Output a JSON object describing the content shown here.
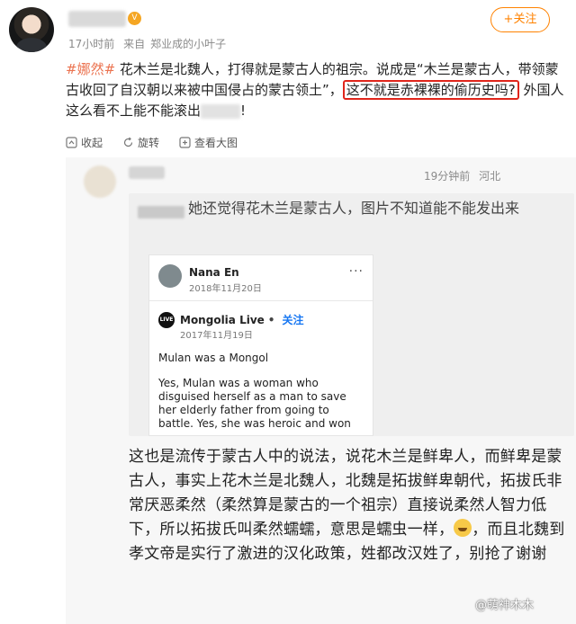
{
  "post": {
    "vip_badge": "V",
    "follow_label": "+关注",
    "time": "17小时前",
    "source_prefix": "来自",
    "source": "郑业成的小叶子",
    "topic": "#娜然#",
    "text_1": " 花木兰是北魏人，打得就是蒙古人的祖宗。说成是“木兰是蒙古人，带领蒙古收回了自汉朝以来被中国侵占的蒙古领土”，",
    "text_highlight": "这不就是赤裸裸的偷历史吗?",
    "text_2": " 外国人这么看不上能不能滚出",
    "text_3": "!",
    "actions": [
      {
        "label": "收起"
      },
      {
        "label": "旋转"
      },
      {
        "label": "查看大图"
      }
    ]
  },
  "comment": {
    "time": "19分钟前",
    "location": "河北",
    "quote_text": "她还觉得花木兰是蒙古人，图片不知道能不能发出来",
    "fb": {
      "name": "Nana En",
      "date": "2018年11月20日",
      "more": "···",
      "page_logo": "LIVE",
      "page_name": "Mongolia Live",
      "dot": "•",
      "follow": "关注",
      "page_date": "2017年11月19日",
      "title": "Mulan was a Mongol",
      "body": "Yes, Mulan was a woman who disguised herself as a man to save her elderly father from going to battle. Yes, she was heroic and won"
    },
    "text_a": "这也是流传于蒙古人中的说法，说花木兰是鲜卑人，而鲜卑是蒙古人，事实上花木兰是北魏人，北魏是拓拔鲜卑朝代，拓拔氏非常厌恶柔然（柔然算是蒙古的一个祖宗）直接说柔然人智力低下，所以拓拔氏叫柔然蠕蠕，意思是蠕虫一样，",
    "text_b": "，而且北魏到孝文帝是实行了激进的汉化政策，姓都改汉姓了，别抢了谢谢"
  },
  "watermark": "@萌神木木"
}
